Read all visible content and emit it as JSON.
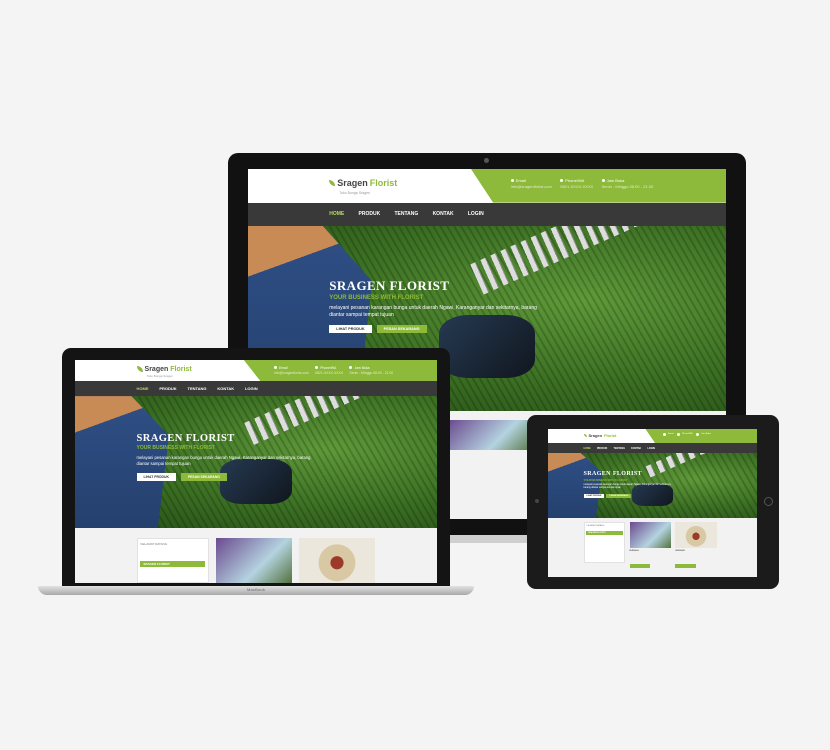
{
  "site": {
    "logo_part1": "Sragen",
    "logo_part2": "Florist",
    "tagline": "Toko Bunga Sragen",
    "contacts": [
      {
        "label": "Email",
        "value": "info@sragenflorist.com"
      },
      {
        "label": "Phone/WA",
        "value": "0821-XXXX-XXXX"
      },
      {
        "label": "Jam Buka",
        "value": "Senin - Minggu 08.00 - 21.00"
      }
    ],
    "nav": [
      "HOME",
      "PRODUK",
      "TENTANG",
      "KONTAK",
      "LOGIN"
    ],
    "hero": {
      "title": "SRAGEN FLORIST",
      "subtitle": "YOUR BUSINESS WITH FLORIST",
      "description": "melayani pesanan karangan bunga untuk daerah Ngawi, Karanganyar dan sekitarnya, barang diantar sampai tempat tujuan",
      "btn_primary": "LIHAT PRODUK",
      "btn_secondary": "PESAN SEKARANG"
    },
    "sidebar_title": "KELAMAT DATANG",
    "sidebar_green": "SRAGEN FLORIST",
    "product_captions": [
      "BUNGA A",
      "BUNGA B"
    ]
  },
  "laptop_brand": "MacBook",
  "colors": {
    "accent": "#8dba3a",
    "nav_bg": "#393939",
    "background": "#f4f4f4"
  }
}
